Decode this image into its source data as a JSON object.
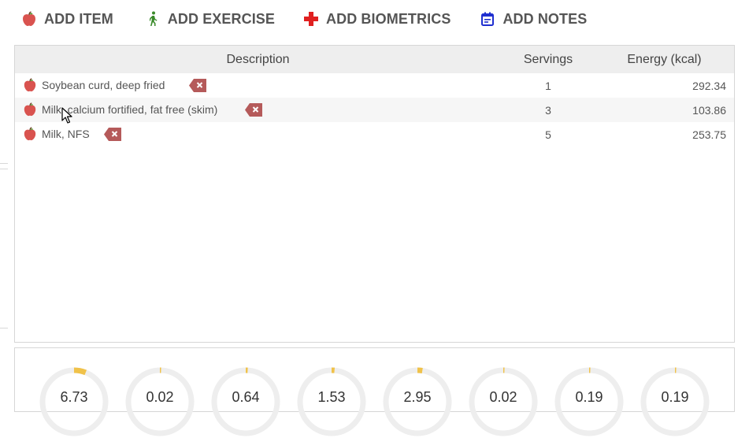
{
  "toolbar": {
    "add_item": "ADD ITEM",
    "add_exercise": "ADD EXERCISE",
    "add_biometrics": "ADD BIOMETRICS",
    "add_notes": "ADD NOTES"
  },
  "colors": {
    "food_icon": "#d9534f",
    "exercise_icon": "#3a8a2a",
    "biometrics_icon": "#e02020",
    "notes_icon": "#1f2fd0",
    "delete_badge": "#b55a5a",
    "gauge_track": "#eeeeee",
    "gauge_fill": "#f0c24a"
  },
  "table": {
    "headers": {
      "description": "Description",
      "servings": "Servings",
      "energy": "Energy (kcal)"
    },
    "rows": [
      {
        "description": "Soybean curd, deep fried",
        "servings": "1",
        "energy": "292.34"
      },
      {
        "description": "Milk, calcium fortified, fat free (skim)",
        "servings": "3",
        "energy": "103.86"
      },
      {
        "description": "Milk, NFS",
        "servings": "5",
        "energy": "253.75"
      }
    ]
  },
  "nutrients": {
    "gauges": [
      {
        "value": "6.73",
        "fraction": 0.06
      },
      {
        "value": "0.02",
        "fraction": 0.005
      },
      {
        "value": "0.64",
        "fraction": 0.01
      },
      {
        "value": "1.53",
        "fraction": 0.015
      },
      {
        "value": "2.95",
        "fraction": 0.025
      },
      {
        "value": "0.02",
        "fraction": 0.005
      },
      {
        "value": "0.19",
        "fraction": 0.005
      },
      {
        "value": "0.19",
        "fraction": 0.005
      }
    ]
  }
}
